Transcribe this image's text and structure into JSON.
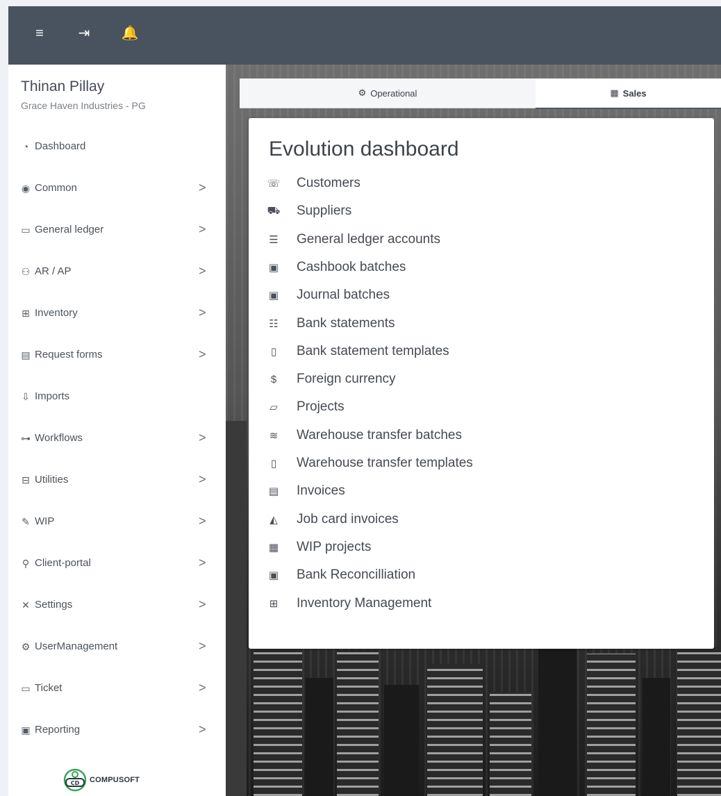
{
  "topbar": {
    "icons": [
      {
        "name": "menu-icon",
        "glyph": "≡",
        "color": "#ffffff"
      },
      {
        "name": "logout-icon",
        "glyph": "⇥",
        "color": "#ffffff"
      },
      {
        "name": "bell-icon",
        "glyph": "🔔",
        "color": "#f6d84a"
      }
    ]
  },
  "user": {
    "name": "Thinan Pillay",
    "company": "Grace Haven Industries - PG"
  },
  "sidebar": {
    "items": [
      {
        "label": "Dashboard",
        "icon": "dashboard-icon",
        "glyph": "◔",
        "has_chevron": false
      },
      {
        "label": "Common",
        "icon": "globe-icon",
        "glyph": "◉",
        "has_chevron": true
      },
      {
        "label": "General ledger",
        "icon": "book-icon",
        "glyph": "▭",
        "has_chevron": true
      },
      {
        "label": "AR / AP",
        "icon": "users-icon",
        "glyph": "⚇",
        "has_chevron": true
      },
      {
        "label": "Inventory",
        "icon": "boxes-icon",
        "glyph": "⊞",
        "has_chevron": true
      },
      {
        "label": "Request forms",
        "icon": "form-icon",
        "glyph": "▤",
        "has_chevron": true
      },
      {
        "label": "Imports",
        "icon": "import-icon",
        "glyph": "⇩",
        "has_chevron": false
      },
      {
        "label": "Workflows",
        "icon": "workflow-icon",
        "glyph": "⊶",
        "has_chevron": true
      },
      {
        "label": "Utilities",
        "icon": "toolbox-icon",
        "glyph": "⊟",
        "has_chevron": true
      },
      {
        "label": "WIP",
        "icon": "tool-icon",
        "glyph": "✎",
        "has_chevron": true
      },
      {
        "label": "Client-portal",
        "icon": "user-icon",
        "glyph": "⚲",
        "has_chevron": true
      },
      {
        "label": "Settings",
        "icon": "tools-icon",
        "glyph": "✕",
        "has_chevron": true
      },
      {
        "label": "UserManagement",
        "icon": "user-cog-icon",
        "glyph": "⚙",
        "has_chevron": true
      },
      {
        "label": "Ticket",
        "icon": "ticket-icon",
        "glyph": "▭",
        "has_chevron": true
      },
      {
        "label": "Reporting",
        "icon": "report-icon",
        "glyph": "▣",
        "has_chevron": true
      }
    ],
    "chevron": ">"
  },
  "logo": {
    "text": "COMPUSOFT"
  },
  "tabs": [
    {
      "label": "Operational",
      "icon": "gears-icon",
      "glyph": "⚙",
      "active": false
    },
    {
      "label": "Sales",
      "icon": "cash-register-icon",
      "glyph": "▦",
      "active": true
    }
  ],
  "dashboard": {
    "title": "Evolution dashboard",
    "links": [
      {
        "label": "Customers",
        "icon": "handshake-icon",
        "glyph": "☏"
      },
      {
        "label": "Suppliers",
        "icon": "truck-icon",
        "glyph": "⛟"
      },
      {
        "label": "General ledger accounts",
        "icon": "ledger-icon",
        "glyph": "☰"
      },
      {
        "label": "Cashbook batches",
        "icon": "money-icon",
        "glyph": "▣"
      },
      {
        "label": "Journal batches",
        "icon": "money-icon",
        "glyph": "▣"
      },
      {
        "label": "Bank statements",
        "icon": "statement-icon",
        "glyph": "☷"
      },
      {
        "label": "Bank statement templates",
        "icon": "file-icon",
        "glyph": "▯"
      },
      {
        "label": "Foreign currency",
        "icon": "dollar-icon",
        "glyph": "$"
      },
      {
        "label": "Projects",
        "icon": "folder-icon",
        "glyph": "▱"
      },
      {
        "label": "Warehouse transfer batches",
        "icon": "layers-icon",
        "glyph": "≋"
      },
      {
        "label": "Warehouse transfer templates",
        "icon": "file-alt-icon",
        "glyph": "▯"
      },
      {
        "label": "Invoices",
        "icon": "invoice-icon",
        "glyph": "▤"
      },
      {
        "label": "Job card invoices",
        "icon": "hard-hat-icon",
        "glyph": "◭"
      },
      {
        "label": "WIP projects",
        "icon": "cash-register-icon",
        "glyph": "▦"
      },
      {
        "label": "Bank Reconcilliation",
        "icon": "money-icon",
        "glyph": "▣"
      },
      {
        "label": "Inventory Management",
        "icon": "boxes-icon",
        "glyph": "⊞"
      }
    ]
  }
}
